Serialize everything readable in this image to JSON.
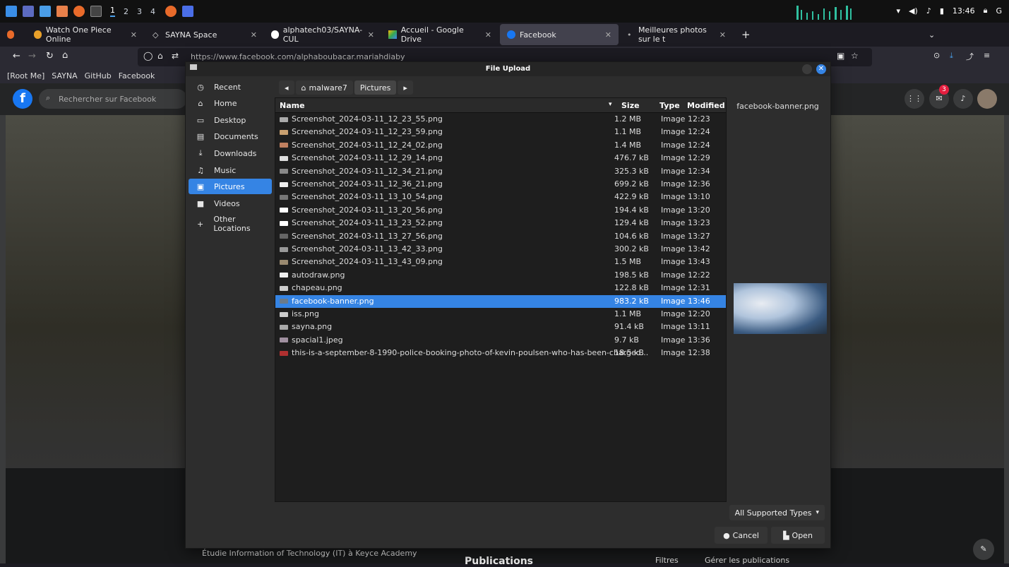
{
  "system": {
    "workspaces": [
      "1",
      "2",
      "3",
      "4"
    ],
    "active_workspace": "1",
    "clock": "13:46"
  },
  "tabs": [
    {
      "label": "Watch One Piece Online"
    },
    {
      "label": "SAYNA Space"
    },
    {
      "label": "alphatech03/SAYNA-CUL"
    },
    {
      "label": "Accueil - Google Drive"
    },
    {
      "label": "Facebook"
    },
    {
      "label": "Meilleures photos sur le t"
    }
  ],
  "url": "https://www.facebook.com/alphaboubacar.mariahdiaby",
  "bookmarks": [
    "[Root Me]",
    "SAYNA",
    "GitHub",
    "Facebook"
  ],
  "facebook": {
    "search_placeholder": "Rechercher sur Facebook",
    "notification_count": "3",
    "intro_line": "Étudie Information of Technology (IT) à Keyce Academy",
    "publications": "Publications",
    "filters": "Filtres",
    "manage": "Gérer les publications"
  },
  "dialog": {
    "title": "File Upload",
    "places": [
      {
        "label": "Recent",
        "icon": "clock-icon"
      },
      {
        "label": "Home",
        "icon": "home-icon"
      },
      {
        "label": "Desktop",
        "icon": "desktop-icon"
      },
      {
        "label": "Documents",
        "icon": "document-icon"
      },
      {
        "label": "Downloads",
        "icon": "download-icon"
      },
      {
        "label": "Music",
        "icon": "music-icon"
      },
      {
        "label": "Pictures",
        "icon": "pictures-icon"
      },
      {
        "label": "Videos",
        "icon": "video-icon"
      },
      {
        "label": "Other Locations",
        "icon": "plus-icon"
      }
    ],
    "selected_place": "Pictures",
    "path": [
      "malware7",
      "Pictures"
    ],
    "columns": {
      "name": "Name",
      "size": "Size",
      "type": "Type",
      "modified": "Modified"
    },
    "files": [
      {
        "name": "Screenshot_2024-03-11_12_23_55.png",
        "size": "1.2 MB",
        "type": "Image",
        "modified": "12:23"
      },
      {
        "name": "Screenshot_2024-03-11_12_23_59.png",
        "size": "1.1 MB",
        "type": "Image",
        "modified": "12:24"
      },
      {
        "name": "Screenshot_2024-03-11_12_24_02.png",
        "size": "1.4 MB",
        "type": "Image",
        "modified": "12:24"
      },
      {
        "name": "Screenshot_2024-03-11_12_29_14.png",
        "size": "476.7 kB",
        "type": "Image",
        "modified": "12:29"
      },
      {
        "name": "Screenshot_2024-03-11_12_34_21.png",
        "size": "325.3 kB",
        "type": "Image",
        "modified": "12:34"
      },
      {
        "name": "Screenshot_2024-03-11_12_36_21.png",
        "size": "699.2 kB",
        "type": "Image",
        "modified": "12:36"
      },
      {
        "name": "Screenshot_2024-03-11_13_10_54.png",
        "size": "422.9 kB",
        "type": "Image",
        "modified": "13:10"
      },
      {
        "name": "Screenshot_2024-03-11_13_20_56.png",
        "size": "194.4 kB",
        "type": "Image",
        "modified": "13:20"
      },
      {
        "name": "Screenshot_2024-03-11_13_23_52.png",
        "size": "129.4 kB",
        "type": "Image",
        "modified": "13:23"
      },
      {
        "name": "Screenshot_2024-03-11_13_27_56.png",
        "size": "104.6 kB",
        "type": "Image",
        "modified": "13:27"
      },
      {
        "name": "Screenshot_2024-03-11_13_42_33.png",
        "size": "300.2 kB",
        "type": "Image",
        "modified": "13:42"
      },
      {
        "name": "Screenshot_2024-03-11_13_43_09.png",
        "size": "1.5 MB",
        "type": "Image",
        "modified": "13:43"
      },
      {
        "name": "autodraw.png",
        "size": "198.5 kB",
        "type": "Image",
        "modified": "12:22"
      },
      {
        "name": "chapeau.png",
        "size": "122.8 kB",
        "type": "Image",
        "modified": "12:31"
      },
      {
        "name": "facebook-banner.png",
        "size": "983.2 kB",
        "type": "Image",
        "modified": "13:46"
      },
      {
        "name": "iss.png",
        "size": "1.1 MB",
        "type": "Image",
        "modified": "12:20"
      },
      {
        "name": "sayna.png",
        "size": "91.4 kB",
        "type": "Image",
        "modified": "13:11"
      },
      {
        "name": "spacial1.jpeg",
        "size": "9.7 kB",
        "type": "Image",
        "modified": "13:36"
      },
      {
        "name": "this-is-a-september-8-1990-police-booking-photo-of-kevin-poulsen-who-has-been-charged...",
        "size": "18.5 kB",
        "type": "Image",
        "modified": "12:38"
      }
    ],
    "selected_file": "facebook-banner.png",
    "preview_name": "facebook-banner.png",
    "filter": "All Supported Types",
    "cancel": "Cancel",
    "open": "Open"
  }
}
